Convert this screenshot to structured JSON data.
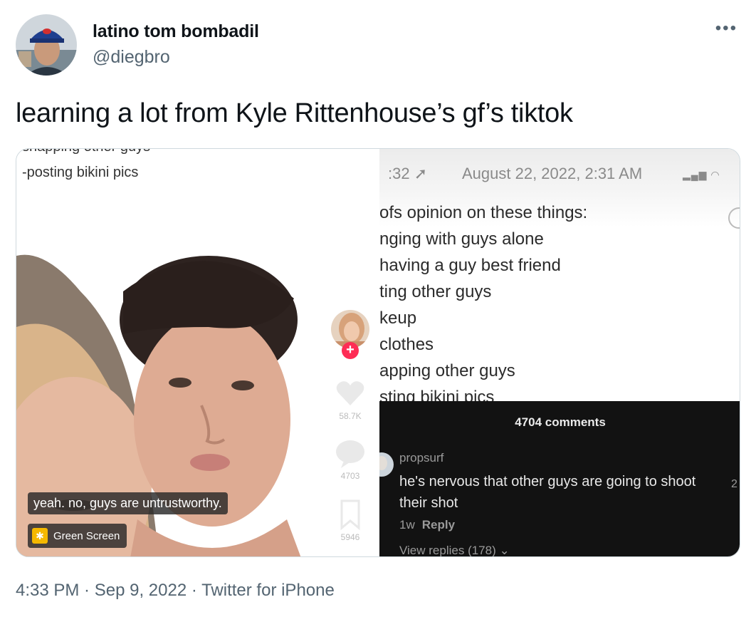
{
  "author": {
    "name": "latino tom bombadil",
    "handle": "@diegbro",
    "more_icon": "more-icon"
  },
  "tweet": {
    "text": "learning a lot from Kyle Rittenhouse’s gf’s tiktok"
  },
  "media": {
    "left": {
      "cut_line": "snapping other guys",
      "line": "-posting bikini pics",
      "caption": "yeah. no, guys are untrustworthy.",
      "green_screen_label": "Green Screen",
      "like_count": "58.7K",
      "comment_count": "4703",
      "save_count": "5946"
    },
    "right": {
      "status_time": ":32",
      "date": "August 22, 2022, 2:31 AM",
      "lines": [
        "ofs opinion on these things:",
        "nging with guys alone",
        " having a guy best friend",
        "ting other guys",
        " keup",
        " clothes",
        "apping other guys",
        "sting bikini pics"
      ],
      "comments": {
        "count_label": "4704 comments",
        "user": "propsurf",
        "text": "he's nervous that other guys are going to shoot their shot",
        "age": "1w",
        "reply_label": "Reply",
        "view_replies": "View replies (178)",
        "likes": "2"
      }
    }
  },
  "footer": {
    "time": "4:33 PM",
    "date": "Sep 9, 2022",
    "source": "Twitter for iPhone",
    "separator": " · "
  }
}
